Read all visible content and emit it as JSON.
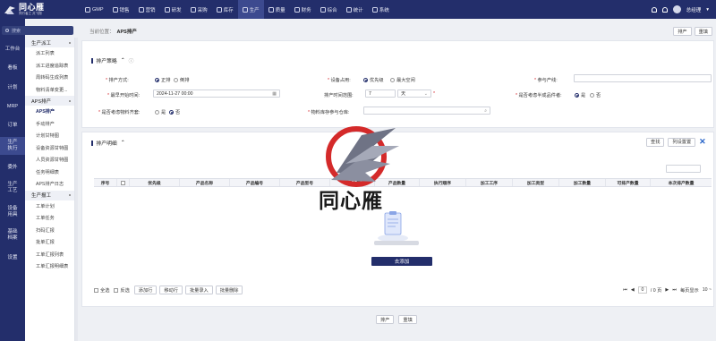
{
  "app": {
    "logo_title": "同心雁",
    "logo_sub": "同行者之 共飞翔"
  },
  "topnav": [
    {
      "label": "GMP",
      "icon": "gear-icon"
    },
    {
      "label": "销售",
      "icon": "chart-icon"
    },
    {
      "label": "营销",
      "icon": "briefcase-icon"
    },
    {
      "label": "研发",
      "icon": "flask-icon"
    },
    {
      "label": "采购",
      "icon": "cart-icon"
    },
    {
      "label": "库存",
      "icon": "box-icon"
    },
    {
      "label": "生产",
      "icon": "tool-icon",
      "active": true
    },
    {
      "label": "质量",
      "icon": "shield-icon"
    },
    {
      "label": "财务",
      "icon": "money-icon"
    },
    {
      "label": "综合",
      "icon": "grid-icon"
    },
    {
      "label": "统计",
      "icon": "stats-icon"
    },
    {
      "label": "系统",
      "icon": "settings-icon"
    }
  ],
  "user": {
    "name": "总经理"
  },
  "search": {
    "placeholder": "搜索"
  },
  "rail": [
    {
      "label": "工作台"
    },
    {
      "label": "看板"
    },
    {
      "label": "计划"
    },
    {
      "label": "MRP"
    },
    {
      "label": "订单"
    },
    {
      "label": "生产执行"
    },
    {
      "label": "委外"
    },
    {
      "label": "生产工艺"
    },
    {
      "label": "设备用具"
    },
    {
      "label": "基础档案"
    },
    {
      "label": "设置"
    }
  ],
  "submenu": {
    "group1": "生产派工",
    "group1_items": [
      "派工列表",
      "派工进度追踪表",
      "周转码生成列表",
      "物料清单变更..."
    ],
    "group2": "APS排产",
    "group2_items": [
      "APS排产",
      "手动排产",
      "计划甘特图",
      "设备资源甘特图",
      "人员资源甘特图",
      "任务明细表",
      "APS排产日志"
    ],
    "group3": "生产报工",
    "group3_items": [
      "工单计划",
      "工单任务",
      "扫码汇报",
      "批单汇报",
      "工单汇报列表",
      "工单汇报明细表"
    ]
  },
  "breadcrumb": {
    "prefix": "当前位置：",
    "current": "APS排产"
  },
  "header_buttons": {
    "schedule": "排产",
    "reset": "重填"
  },
  "params": {
    "title": "排产策略",
    "method_label": "排产方式:",
    "method_forward": "正排",
    "method_backward": "倒排",
    "device_label": "设备占用:",
    "device_priority": "优先级",
    "device_max": "最大空闲",
    "line_label": "参与产线:",
    "start_label": "最早开始时间:",
    "start_value": "2024-11-27 00:00",
    "range_label": "排产时间范围:",
    "range_value": "7",
    "range_unit": "天",
    "semi_label": "是否考虑半成品件者:",
    "semi_yes": "是",
    "semi_no": "否",
    "material_label": "是否考虑物料齐套:",
    "material_yes": "是",
    "material_no": "否",
    "warehouse_label": "物料库存参与仓库:"
  },
  "detail": {
    "title": "排产明细",
    "find": "查找",
    "column_settings": "列设置置"
  },
  "table": {
    "columns": [
      "序号",
      "",
      "优先级",
      "产品名称",
      "产品编号",
      "产品型号",
      "单据主题",
      "产品数量",
      "执行顺序",
      "加工工序",
      "加工类型",
      "加工数量",
      "可排产数量",
      "本次排产数量"
    ]
  },
  "empty": {
    "add_button": "去添加"
  },
  "footer": {
    "select_all": "全选",
    "invert": "反选",
    "add_row": "添加行",
    "move_row": "移动行",
    "batch_import": "批量录入",
    "batch_delete": "批量删除",
    "page_current": "0",
    "page_total": "/ 0 页",
    "per_page_label": "每页显示",
    "per_page": "10 ~"
  },
  "bottom": {
    "schedule": "排产",
    "reset": "重填"
  },
  "watermark": {
    "text": "同心雁"
  },
  "colors": {
    "brand": "#232e6b",
    "accent_red": "#d4282e"
  }
}
